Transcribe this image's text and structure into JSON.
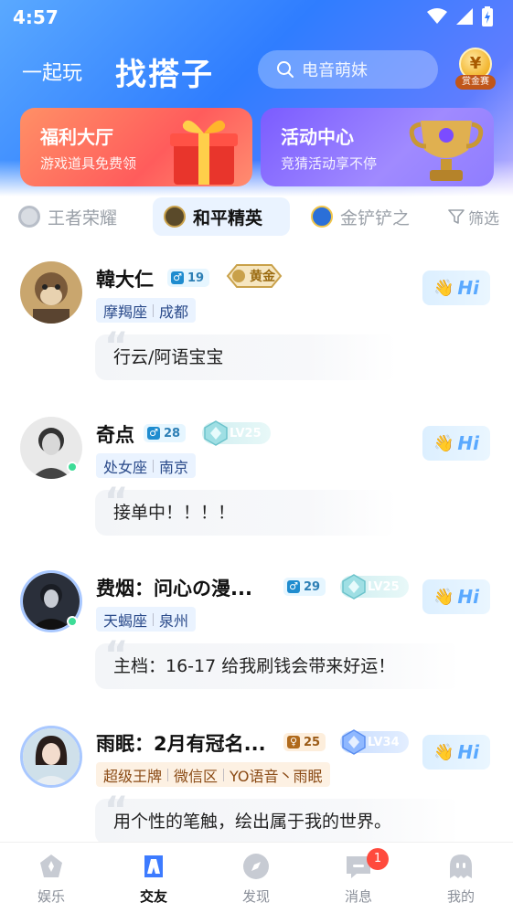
{
  "status_bar": {
    "time": "4:57"
  },
  "header": {
    "play_label": "一起玩",
    "title": "找搭子",
    "search_placeholder": "电音萌妹",
    "bounty_coin": "¥",
    "bounty_label": "赏金赛"
  },
  "banners": [
    {
      "title": "福利大厅",
      "subtitle": "游戏道具免费领"
    },
    {
      "title": "活动中心",
      "subtitle": "竞猜活动享不停"
    }
  ],
  "game_tabs": {
    "items": [
      "王者荣耀",
      "和平精英",
      "金铲铲之"
    ],
    "selected": "和平精英",
    "filter_label": "筛选"
  },
  "users": [
    {
      "name": "韓大仁",
      "gender": "male",
      "gender_symbol": "♂",
      "age": "19",
      "rank_label": "黄金",
      "tags": [
        "摩羯座",
        "成都"
      ],
      "bio": "行云/阿语宝宝",
      "online": false
    },
    {
      "name": "奇点",
      "gender": "male",
      "gender_symbol": "♂",
      "age": "28",
      "level": "LV25",
      "tags": [
        "处女座",
        "南京"
      ],
      "bio": "接单中！！！！",
      "online": true
    },
    {
      "name": "费烟：问心の漫...",
      "gender": "male",
      "gender_symbol": "♂",
      "age": "29",
      "level": "LV25",
      "tags": [
        "天蝎座",
        "泉州"
      ],
      "bio": "主档：16-17 给我刷钱会带来好运！",
      "online": true
    },
    {
      "name": "雨眠：2月有冠名...",
      "gender": "female",
      "gender_symbol": "♀",
      "age": "25",
      "level": "LV34",
      "tags": [
        "超级王牌",
        "微信区",
        "YO语音丶雨眠"
      ],
      "bio": "用个性的笔触，绘出属于我的世界。",
      "online": false
    }
  ],
  "hi_label": "Hi",
  "hi_hand": "👋",
  "bottom_nav": {
    "items": [
      {
        "label": "娱乐"
      },
      {
        "label": "交友"
      },
      {
        "label": "发现"
      },
      {
        "label": "消息",
        "badge": "1"
      },
      {
        "label": "我的"
      }
    ],
    "active": "交友"
  },
  "colors": {
    "primary_blue": "#2f7dff",
    "online_green": "#3ddc97",
    "badge_red": "#ff4a3d"
  }
}
